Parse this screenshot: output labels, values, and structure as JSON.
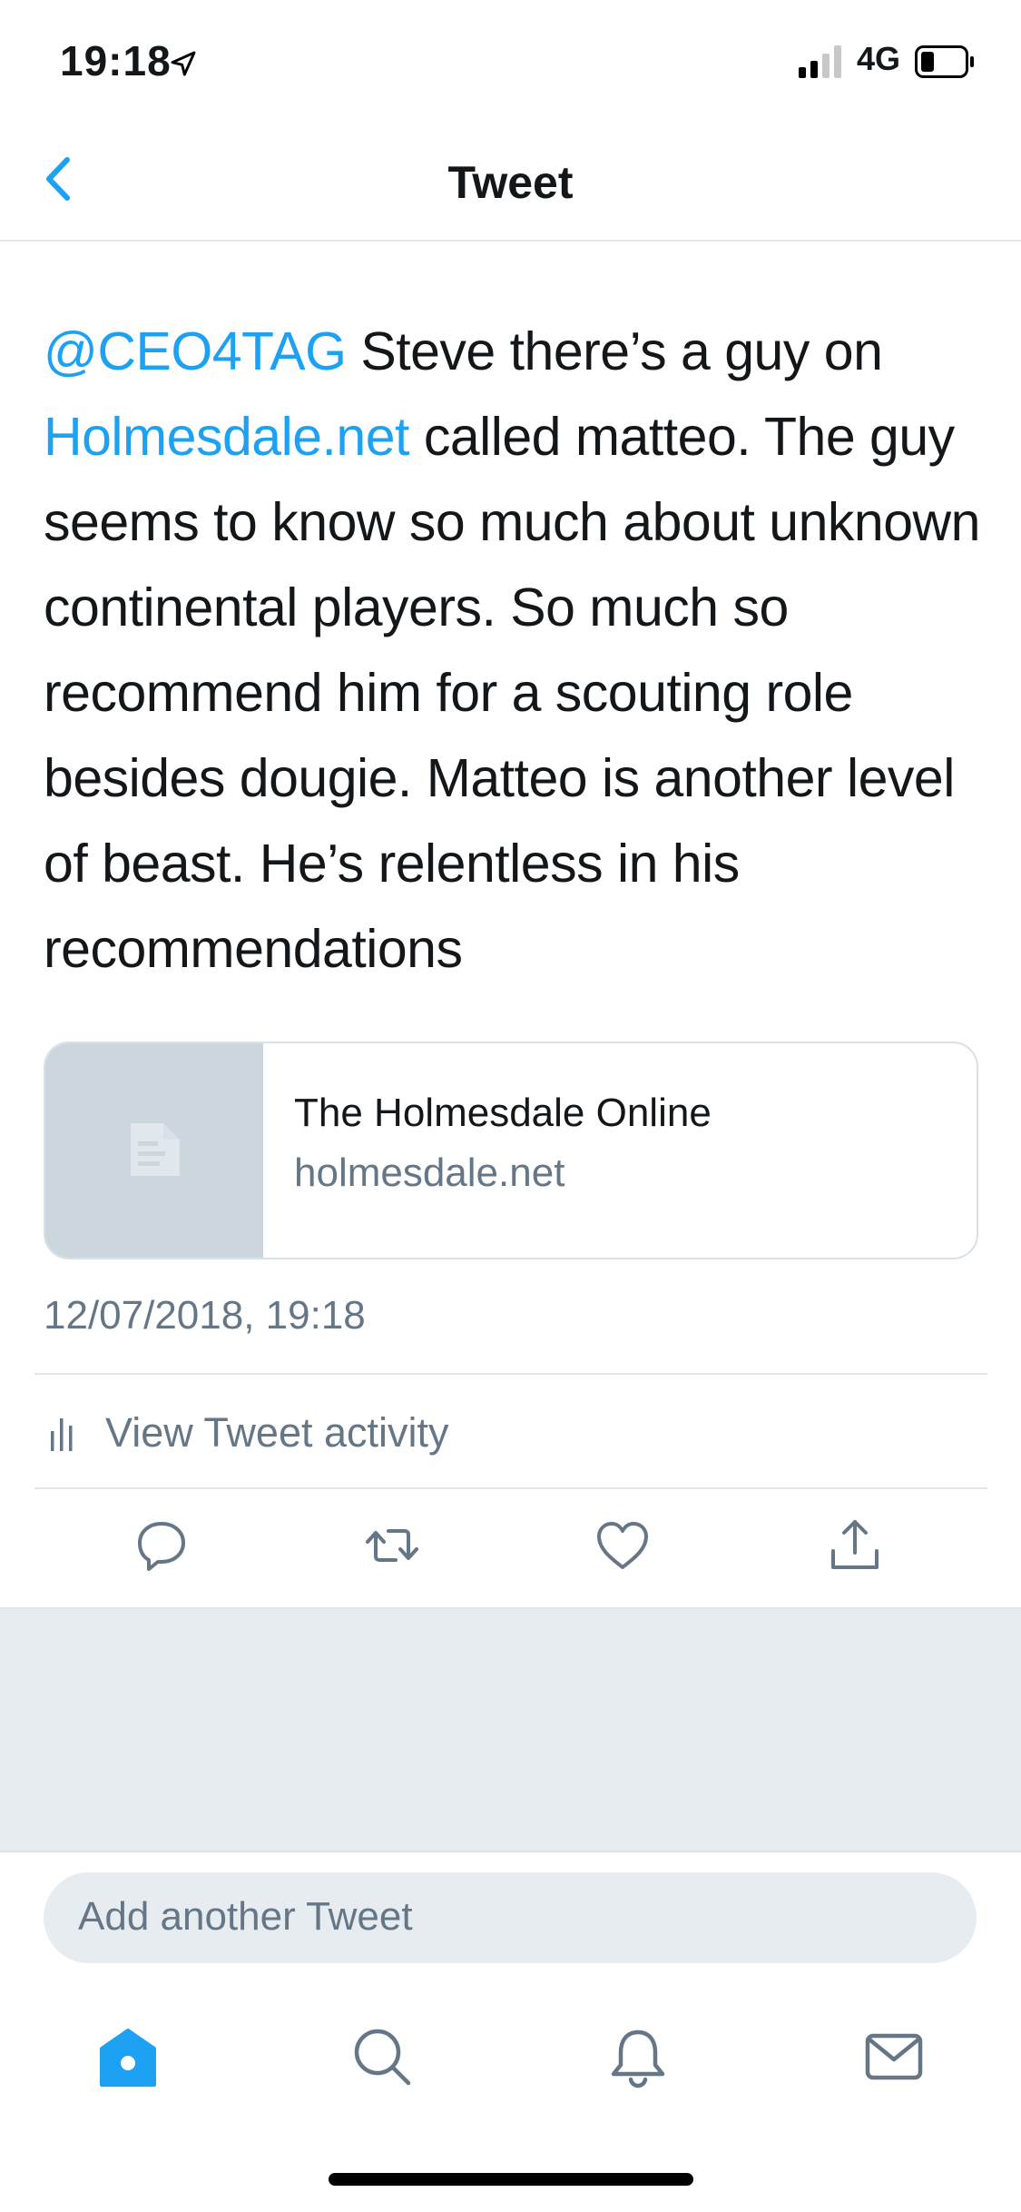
{
  "status_bar": {
    "time": "19:18",
    "network": "4G",
    "icons": [
      "location-arrow-icon",
      "signal-icon",
      "battery-icon"
    ]
  },
  "nav": {
    "title": "Tweet",
    "back_icon": "chevron-left-icon"
  },
  "tweet": {
    "mention": "@CEO4TAG",
    "text_part1": " Steve there’s a guy on ",
    "link": "Holmesdale.net",
    "text_part2": " called matteo. The guy seems to know so much about unknown continental players. So much so recommend him for a scouting role besides dougie. Matteo is another level of beast. He’s relentless in his recommendations",
    "timestamp": "12/07/2018, 19:18"
  },
  "card": {
    "title": "The Holmesdale Online",
    "domain": "holmesdale.net",
    "thumb_icon": "document-icon"
  },
  "activity": {
    "label": "View Tweet activity",
    "icon": "bar-chart-icon"
  },
  "actions": [
    "reply-icon",
    "retweet-icon",
    "like-icon",
    "share-icon"
  ],
  "composer": {
    "placeholder": "Add another Tweet"
  },
  "tabbar": [
    "home-icon",
    "search-icon",
    "notifications-icon",
    "messages-icon"
  ],
  "colors": {
    "accent": "#1da1f2",
    "text": "#14171a",
    "secondary": "#657786",
    "divider": "#e1e8ed",
    "gray_bg": "#e6ecf0"
  }
}
